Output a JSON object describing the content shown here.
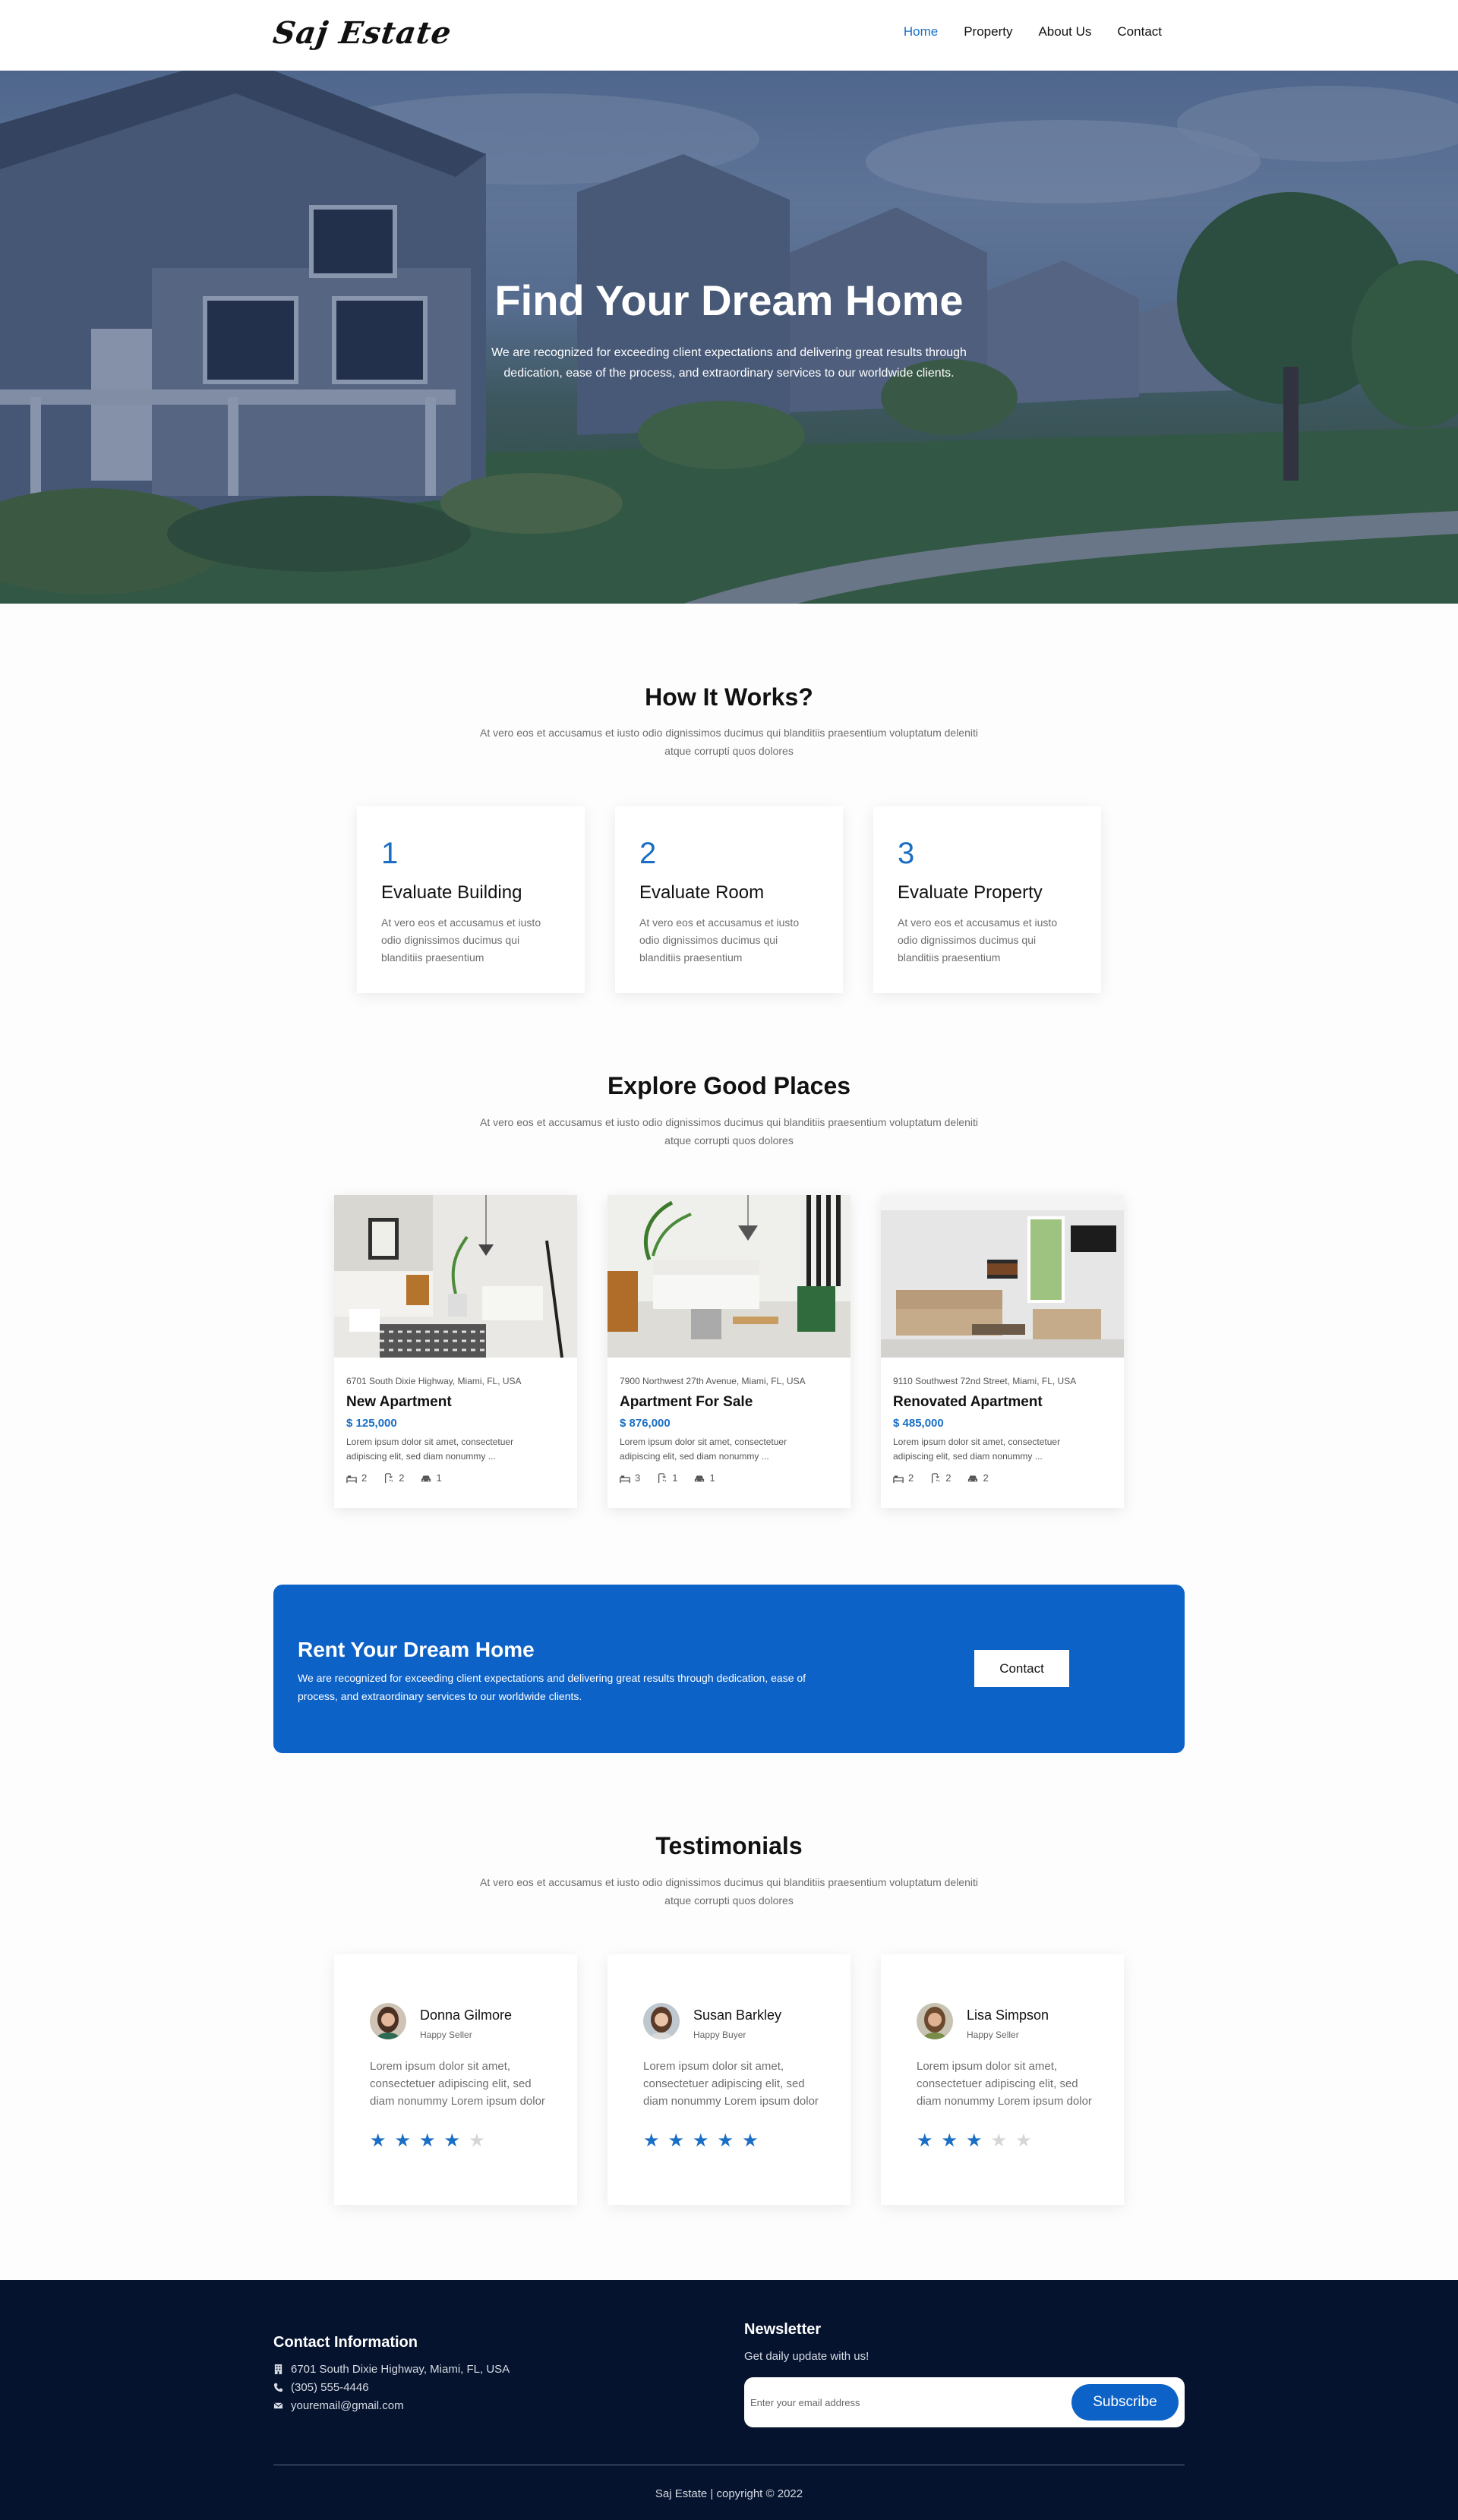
{
  "brand": {
    "logo": "Saj Estate"
  },
  "nav": {
    "items": [
      {
        "label": "Home",
        "active": true
      },
      {
        "label": "Property"
      },
      {
        "label": "About Us"
      },
      {
        "label": "Contact"
      }
    ]
  },
  "hero": {
    "title": "Find Your Dream Home",
    "subtitle": "We are recognized for exceeding client expectations and delivering great results through dedication, ease of the process, and extraordinary services to our worldwide clients."
  },
  "how_it_works": {
    "title": "How It Works?",
    "subtitle": "At vero eos et accusamus et iusto odio dignissimos ducimus qui blanditiis praesentium voluptatum deleniti atque corrupti quos dolores",
    "steps": [
      {
        "number": "1",
        "title": "Evaluate Building",
        "text": "At vero eos et accusamus et iusto odio dignissimos ducimus qui blanditiis praesentium"
      },
      {
        "number": "2",
        "title": "Evaluate Room",
        "text": "At vero eos et accusamus et iusto odio dignissimos ducimus qui blanditiis praesentium"
      },
      {
        "number": "3",
        "title": "Evaluate Property",
        "text": "At vero eos et accusamus et iusto odio dignissimos ducimus qui blanditiis praesentium"
      }
    ]
  },
  "explore": {
    "title": "Explore Good Places",
    "subtitle": "At vero eos et accusamus et iusto odio dignissimos ducimus qui blanditiis praesentium voluptatum deleniti atque corrupti quos dolores",
    "properties": [
      {
        "address": "6701 South Dixie Highway, Miami, FL, USA",
        "name": "New Apartment",
        "price": "$ 125,000",
        "description": "Lorem ipsum dolor sit amet, consectetuer adipiscing elit, sed diam nonummy ...",
        "beds": "2",
        "baths": "2",
        "garage": "1"
      },
      {
        "address": "7900 Northwest 27th Avenue, Miami, FL, USA",
        "name": "Apartment For Sale",
        "price": "$ 876,000",
        "description": "Lorem ipsum dolor sit amet, consectetuer adipiscing elit, sed diam nonummy ...",
        "beds": "3",
        "baths": "1",
        "garage": "1"
      },
      {
        "address": "9110 Southwest 72nd Street, Miami, FL, USA",
        "name": "Renovated Apartment",
        "price": "$ 485,000",
        "description": "Lorem ipsum dolor sit amet, consectetuer adipiscing elit, sed diam nonummy ...",
        "beds": "2",
        "baths": "2",
        "garage": "2"
      }
    ]
  },
  "rent": {
    "title": "Rent Your Dream Home",
    "text": "We are recognized for exceeding client expectations and delivering great results through dedication, ease of process, and extraordinary services to our worldwide clients.",
    "button": "Contact"
  },
  "testimonials": {
    "title": "Testimonials",
    "subtitle": "At vero eos et accusamus et iusto odio dignissimos ducimus qui blanditiis praesentium voluptatum deleniti atque corrupti quos dolores",
    "items": [
      {
        "name": "Donna Gilmore",
        "role": "Happy Seller",
        "text": "Lorem ipsum dolor sit amet, consectetuer adipiscing elit, sed diam nonummy Lorem ipsum dolor",
        "rating": 4
      },
      {
        "name": "Susan Barkley",
        "role": "Happy Buyer",
        "text": "Lorem ipsum dolor sit amet, consectetuer adipiscing elit, sed diam nonummy Lorem ipsum dolor",
        "rating": 5
      },
      {
        "name": "Lisa Simpson",
        "role": "Happy Seller",
        "text": "Lorem ipsum dolor sit amet, consectetuer adipiscing elit, sed diam nonummy Lorem ipsum dolor",
        "rating": 3
      }
    ]
  },
  "footer": {
    "contact_title": "Contact Information",
    "address": "6701 South Dixie Highway, Miami, FL, USA",
    "phone": "(305) 555-4446",
    "email": "youremail@gmail.com",
    "newsletter_title": "Newsletter",
    "newsletter_sub": "Get daily update with us!",
    "email_placeholder": "Enter your email address",
    "subscribe": "Subscribe",
    "copyright": "Saj Estate | copyright © 2022"
  },
  "colors": {
    "accent": "#1a6fc4",
    "banner": "#0d62c8",
    "footer": "#05132e"
  }
}
